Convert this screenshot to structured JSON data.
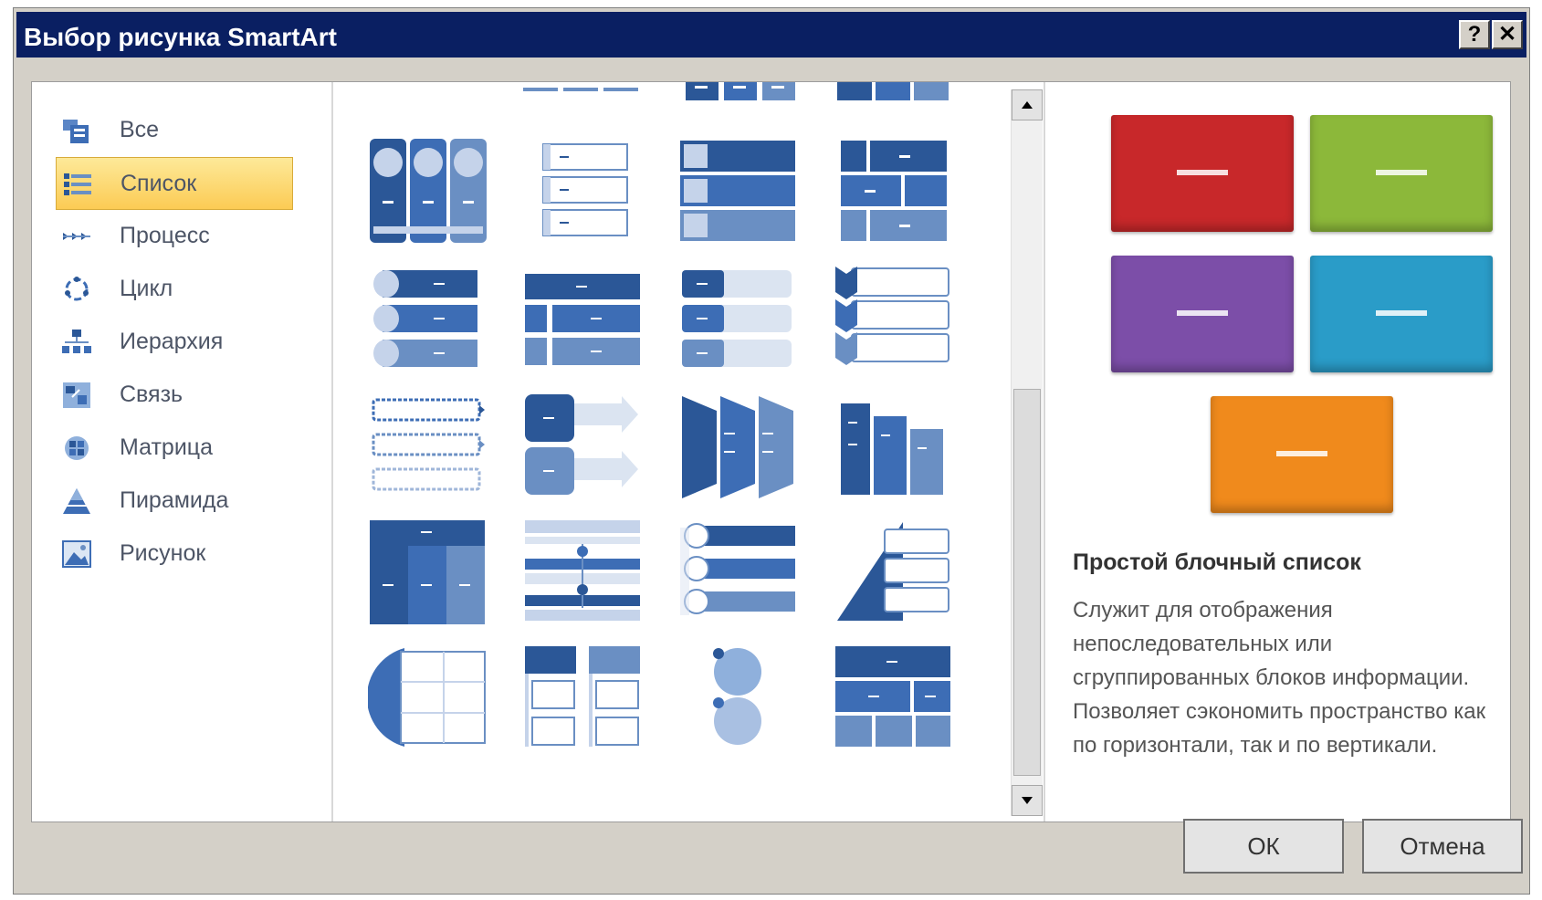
{
  "window": {
    "title": "Выбор рисунка SmartArt",
    "help_label": "?",
    "close_label": "✕"
  },
  "categories": [
    {
      "label": "Все",
      "icon": "all-layouts-icon",
      "selected": false
    },
    {
      "label": "Список",
      "icon": "list-icon",
      "selected": true
    },
    {
      "label": "Процесс",
      "icon": "process-icon",
      "selected": false
    },
    {
      "label": "Цикл",
      "icon": "cycle-icon",
      "selected": false
    },
    {
      "label": "Иерархия",
      "icon": "hierarchy-icon",
      "selected": false
    },
    {
      "label": "Связь",
      "icon": "relationship-icon",
      "selected": false
    },
    {
      "label": "Матрица",
      "icon": "matrix-icon",
      "selected": false
    },
    {
      "label": "Пирамида",
      "icon": "pyramid-icon",
      "selected": false
    },
    {
      "label": "Рисунок",
      "icon": "picture-icon",
      "selected": false
    }
  ],
  "preview": {
    "title": "Простой блочный список",
    "description": "Служит для отображения непоследовательных или сгруппированных блоков информации. Позволяет сэкономить пространство как по горизонтали, так и по вертикали.",
    "colors": [
      "#c8282a",
      "#8cb83a",
      "#7c4ea8",
      "#2a9cc8",
      "#f08a1c"
    ]
  },
  "buttons": {
    "ok": "ОК",
    "cancel": "Отмена"
  },
  "theme": {
    "titlebar": "#0a1f62",
    "selection": "#fcd660",
    "thumb_dark": "#2b5797",
    "thumb_mid": "#6a8fc3",
    "thumb_light": "#c5d3ea"
  }
}
